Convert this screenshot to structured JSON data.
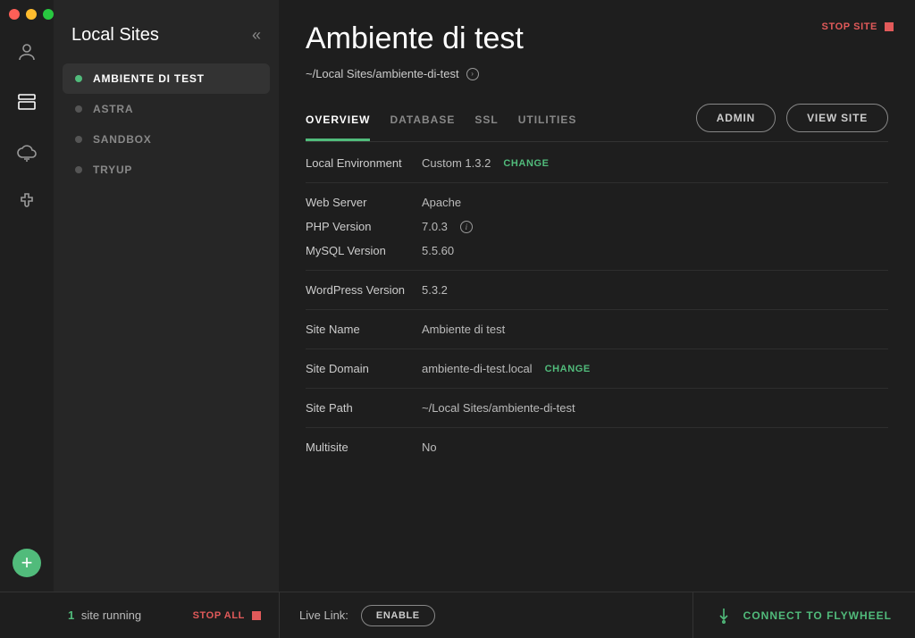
{
  "sidebar": {
    "title": "Local Sites",
    "items": [
      {
        "label": "AMBIENTE DI TEST",
        "running": true,
        "active": true
      },
      {
        "label": "ASTRA",
        "running": false,
        "active": false
      },
      {
        "label": "SANDBOX",
        "running": false,
        "active": false
      },
      {
        "label": "TRYUP",
        "running": false,
        "active": false
      }
    ]
  },
  "site": {
    "title": "Ambiente di test",
    "path_display": "~/Local Sites/ambiente-di-test",
    "stop_label": "STOP SITE"
  },
  "tabs": {
    "items": [
      "OVERVIEW",
      "DATABASE",
      "SSL",
      "UTILITIES"
    ],
    "active": "OVERVIEW"
  },
  "buttons": {
    "admin": "ADMIN",
    "view_site": "VIEW SITE"
  },
  "overview": {
    "local_env_label": "Local Environment",
    "local_env_value": "Custom 1.3.2",
    "change": "CHANGE",
    "web_server_label": "Web Server",
    "web_server_value": "Apache",
    "php_label": "PHP Version",
    "php_value": "7.0.3",
    "mysql_label": "MySQL Version",
    "mysql_value": "5.5.60",
    "wp_label": "WordPress Version",
    "wp_value": "5.3.2",
    "site_name_label": "Site Name",
    "site_name_value": "Ambiente di test",
    "domain_label": "Site Domain",
    "domain_value": "ambiente-di-test.local",
    "site_path_label": "Site Path",
    "site_path_value": "~/Local Sites/ambiente-di-test",
    "multisite_label": "Multisite",
    "multisite_value": "No"
  },
  "footer": {
    "running_count": "1",
    "running_text": "site running",
    "stop_all": "STOP ALL",
    "live_link_label": "Live Link:",
    "enable": "ENABLE",
    "connect": "CONNECT TO FLYWHEEL"
  }
}
